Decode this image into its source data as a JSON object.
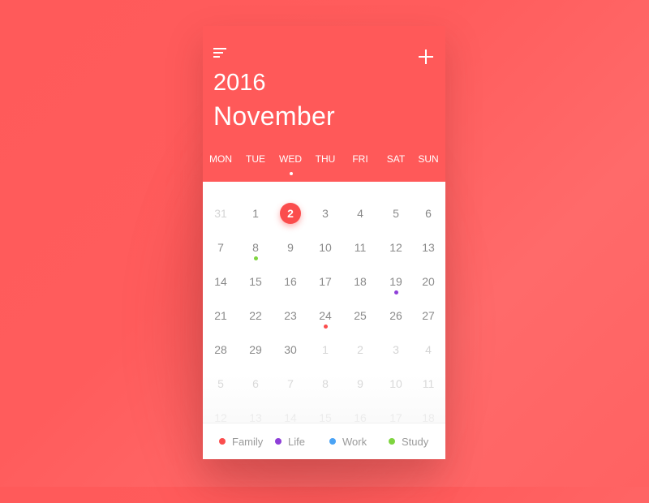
{
  "header": {
    "year": "2016",
    "month": "November",
    "menu_icon": "menu-icon",
    "add_icon": "plus-icon",
    "background_color": "#ff5959"
  },
  "weekdays": [
    "MON",
    "TUE",
    "WED",
    "THU",
    "FRI",
    "SAT",
    "SUN"
  ],
  "current_weekday_index": 2,
  "calendar": {
    "weeks": [
      [
        {
          "d": "31",
          "muted": true
        },
        {
          "d": "1"
        },
        {
          "d": "2",
          "today": true
        },
        {
          "d": "3"
        },
        {
          "d": "4"
        },
        {
          "d": "5"
        },
        {
          "d": "6"
        }
      ],
      [
        {
          "d": "7"
        },
        {
          "d": "8",
          "event": "study"
        },
        {
          "d": "9"
        },
        {
          "d": "10"
        },
        {
          "d": "11"
        },
        {
          "d": "12"
        },
        {
          "d": "13"
        }
      ],
      [
        {
          "d": "14"
        },
        {
          "d": "15"
        },
        {
          "d": "16"
        },
        {
          "d": "17"
        },
        {
          "d": "18"
        },
        {
          "d": "19",
          "event": "life"
        },
        {
          "d": "20"
        }
      ],
      [
        {
          "d": "21"
        },
        {
          "d": "22"
        },
        {
          "d": "23"
        },
        {
          "d": "24",
          "event": "family"
        },
        {
          "d": "25"
        },
        {
          "d": "26"
        },
        {
          "d": "27"
        }
      ],
      [
        {
          "d": "28"
        },
        {
          "d": "29"
        },
        {
          "d": "30"
        },
        {
          "d": "1",
          "muted": true
        },
        {
          "d": "2",
          "muted": true
        },
        {
          "d": "3",
          "muted": true
        },
        {
          "d": "4",
          "muted": true
        }
      ],
      [
        {
          "d": "5",
          "muted": true
        },
        {
          "d": "6",
          "muted": true
        },
        {
          "d": "7",
          "muted": true
        },
        {
          "d": "8",
          "muted": true
        },
        {
          "d": "9",
          "muted": true
        },
        {
          "d": "10",
          "muted": true
        },
        {
          "d": "11",
          "muted": true
        }
      ],
      [
        {
          "d": "12",
          "muted": true
        },
        {
          "d": "13",
          "muted": true
        },
        {
          "d": "14",
          "muted": true
        },
        {
          "d": "15",
          "muted": true
        },
        {
          "d": "16",
          "muted": true
        },
        {
          "d": "17",
          "muted": true
        },
        {
          "d": "18",
          "muted": true
        }
      ]
    ]
  },
  "legend": [
    {
      "key": "family",
      "label": "Family",
      "color": "#fb4d4d"
    },
    {
      "key": "life",
      "label": "Life",
      "color": "#8e3fd8"
    },
    {
      "key": "work",
      "label": "Work",
      "color": "#4aa3f5"
    },
    {
      "key": "study",
      "label": "Study",
      "color": "#7ed43f"
    }
  ]
}
